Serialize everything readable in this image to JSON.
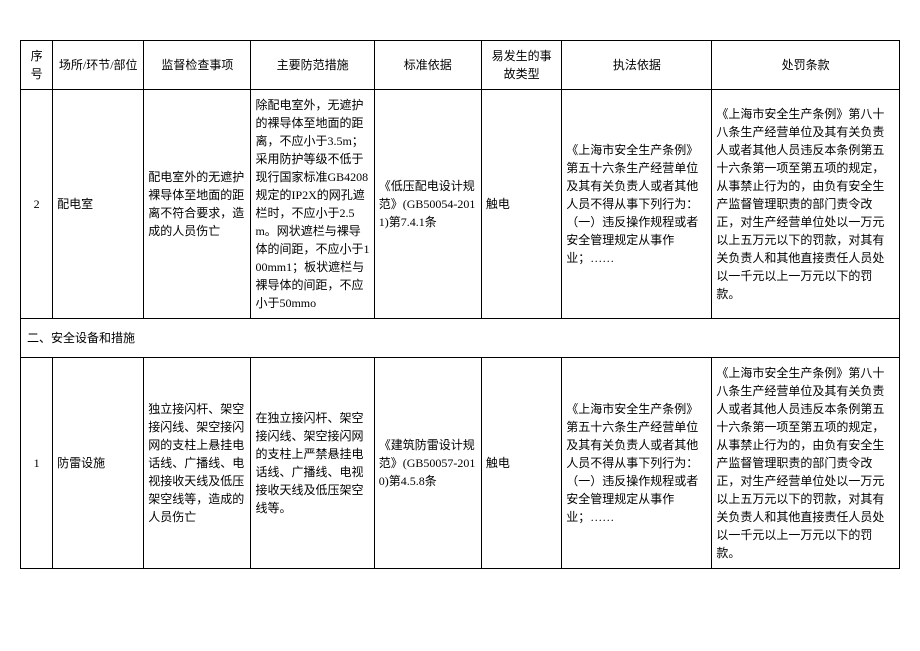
{
  "headers": {
    "seq": "序号",
    "place": "场所/环节/部位",
    "inspect": "监督检查事项",
    "prevent": "主要防范措施",
    "standard": "标准依据",
    "accident": "易发生的事故类型",
    "basis": "执法依据",
    "penalty": "处罚条款"
  },
  "rows": [
    {
      "seq": "2",
      "place": "配电室",
      "inspect": "配电室外的无遮护裸导体至地面的距离不符合要求，造成的人员伤亡",
      "prevent": "除配电室外，无遮护的裸导体至地面的距离，不应小于3.5m；采用防护等级不低于现行国家标准GB4208规定的IP2X的网孔遮栏时，不应小于2.5m。网状遮栏与裸导体的间距，不应小于100mm1；板状遮栏与裸导体的间距，不应小于50mmo",
      "standard": "《低压配电设计规范》(GB50054-2011)第7.4.1条",
      "accident": "触电",
      "basis": "《上海市安全生产条例》第五十六条生产经营单位及其有关负责人或者其他人员不得从事下列行为：（一）违反操作规程或者安全管理规定从事作业；……",
      "penalty": "《上海市安全生产条例》第八十八条生产经营单位及其有关负责人或者其他人员违反本条例第五十六条第一项至第五项的规定，从事禁止行为的，由负有安全生产监督管理职责的部门责令改正，对生产经营单位处以一万元以上五万元以下的罚款，对其有关负责人和其他直接责任人员处以一千元以上一万元以下的罚款。"
    }
  ],
  "section": {
    "title": "二、安全设备和措施"
  },
  "rows2": [
    {
      "seq": "1",
      "place": "防雷设施",
      "inspect": "独立接闪杆、架空接闪线、架空接闪网的支柱上悬挂电话线、广播线、电视接收天线及低压架空线等，造成的人员伤亡",
      "prevent": "在独立接闪杆、架空接闪线、架空接闪网的支柱上严禁悬挂电话线、广播线、电视接收天线及低压架空线等。",
      "standard": "《建筑防雷设计规范》(GB50057-2010)第4.5.8条",
      "accident": "触电",
      "basis": "《上海市安全生产条例》第五十六条生产经营单位及其有关负责人或者其他人员不得从事下列行为：（一）违反操作规程或者安全管理规定从事作业；……",
      "penalty": "《上海市安全生产条例》第八十八条生产经营单位及其有关负责人或者其他人员违反本条例第五十六条第一项至第五项的规定，从事禁止行为的，由负有安全生产监督管理职责的部门责令改正，对生产经营单位处以一万元以上五万元以下的罚款，对其有关负责人和其他直接责任人员处以一千元以上一万元以下的罚款。"
    }
  ]
}
